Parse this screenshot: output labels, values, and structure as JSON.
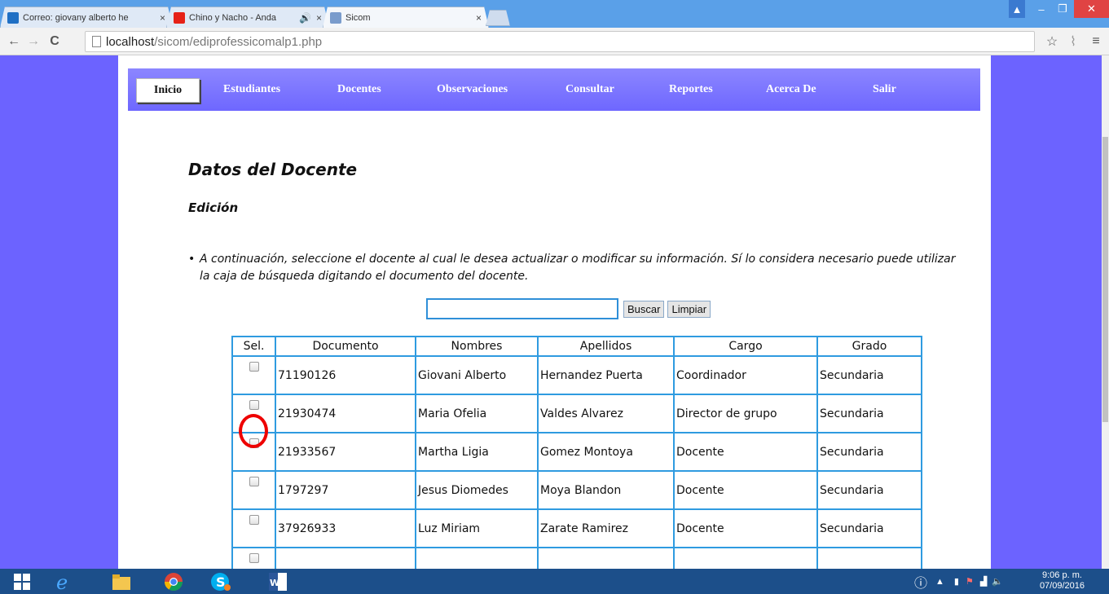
{
  "browser": {
    "tabs": [
      {
        "title": "Correo: giovany alberto he",
        "favicon_color": "#1f6fc4"
      },
      {
        "title": "Chino y Nacho - Anda",
        "favicon_color": "#e62117"
      },
      {
        "title": "Sicom",
        "favicon_color": "#7a9ccc"
      }
    ],
    "address": {
      "host": "localhost",
      "path": "/sicom/ediprofessicomalp1.php"
    },
    "controls": {
      "back": "←",
      "forward": "→",
      "reload": "C",
      "star": "☆",
      "menu": "≡",
      "minimize": "–",
      "maximize": "❐",
      "close": "✕"
    }
  },
  "menu": {
    "items": [
      "Inicio",
      "Estudiantes",
      "Docentes",
      "Observaciones",
      "Consultar",
      "Reportes",
      "Acerca De",
      "Salir"
    ]
  },
  "header": {
    "title": "Datos del Docente",
    "subtitle": "Edición"
  },
  "instructions": "A continuación, seleccione el docente al cual le desea actualizar o modificar su información. Sí lo considera necesario puede utilizar la caja de búsqueda digitando el documento del docente.",
  "search": {
    "value": "",
    "button_label": "Buscar",
    "clear_label": "Limpiar"
  },
  "table": {
    "headers": [
      "Sel.",
      "Documento",
      "Nombres",
      "Apellidos",
      "Cargo",
      "Grado"
    ],
    "rows": [
      {
        "documento": "71190126",
        "nombres": "Giovani Alberto",
        "apellidos": "Hernandez Puerta",
        "cargo": "Coordinador",
        "grado": "Secundaria"
      },
      {
        "documento": "21930474",
        "nombres": "Maria Ofelia",
        "apellidos": "Valdes Alvarez",
        "cargo": "Director de grupo",
        "grado": "Secundaria"
      },
      {
        "documento": "21933567",
        "nombres": "Martha Ligia",
        "apellidos": "Gomez Montoya",
        "cargo": "Docente",
        "grado": "Secundaria"
      },
      {
        "documento": "1797297",
        "nombres": "Jesus Diomedes",
        "apellidos": "Moya Blandon",
        "cargo": "Docente",
        "grado": "Secundaria"
      },
      {
        "documento": "37926933",
        "nombres": "Luz Miriam",
        "apellidos": "Zarate Ramirez",
        "cargo": "Docente",
        "grado": "Secundaria"
      }
    ]
  },
  "taskbar": {
    "clock_time": "9:06 p. m.",
    "clock_date": "07/09/2016"
  },
  "colors": {
    "page_bg": "#6c63ff",
    "menu_bar": "#7a74ff",
    "table_border": "#2f9be0",
    "marker": "#e00000"
  }
}
